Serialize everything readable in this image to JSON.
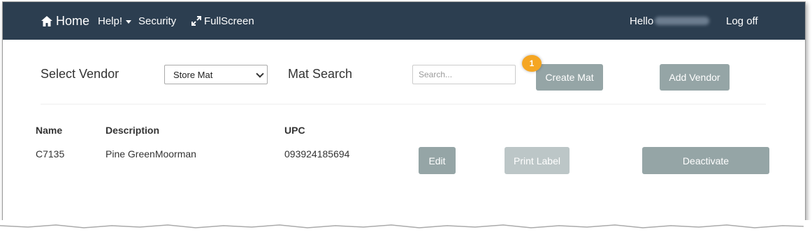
{
  "navbar": {
    "home_label": "Home",
    "help_label": "Help!",
    "security_label": "Security",
    "fullscreen_label": "FullScreen",
    "hello_label": "Hello",
    "logoff_label": "Log off",
    "bg_color": "#2c3e50"
  },
  "toolbar": {
    "select_vendor_label": "Select Vendor",
    "vendor_selected": "Store Mat",
    "mat_search_label": "Mat Search",
    "search_placeholder": "Search...",
    "create_mat_label": "Create Mat",
    "add_vendor_label": "Add Vendor",
    "callout_number": "1"
  },
  "table": {
    "headers": {
      "name": "Name",
      "description": "Description",
      "upc": "UPC"
    },
    "rows": [
      {
        "name": "C7135",
        "description": "Pine GreenMoorman",
        "upc": "093924185694",
        "edit_label": "Edit",
        "print_label": "Print Label",
        "deactivate_label": "Deactivate"
      }
    ]
  },
  "colors": {
    "button": "#95a5a6",
    "button_disabled": "#bcc6c7",
    "callout": "#f5a623"
  }
}
